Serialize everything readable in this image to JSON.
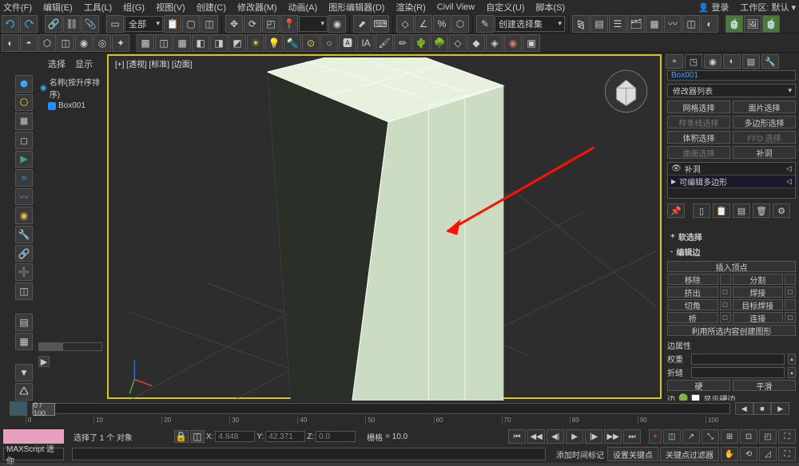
{
  "menu": {
    "file": "文件(F)",
    "edit": "编辑(E)",
    "tools": "工具(L)",
    "group": "组(G)",
    "views": "视图(V)",
    "create": "创建(C)",
    "modifiers": "修改器(M)",
    "animation": "动画(A)",
    "graph": "图形编辑器(D)",
    "render": "渲染(R)",
    "civil": "Civil View",
    "custom": "自定义(U)",
    "script": "脚本(S)",
    "login": "登录",
    "workspace": "工作区: 默认"
  },
  "toolbar": {
    "dropdown1": "全部",
    "dropdown2": "创建选择集"
  },
  "scene": {
    "tabs": {
      "select": "选择",
      "display": "显示"
    },
    "header": "名称(按升序排序)",
    "item": "Box001"
  },
  "viewport": {
    "label": "[+] [透视] [标准] [边面]"
  },
  "cmd": {
    "objname": "Box001",
    "modifier_list": "修改器列表",
    "btns": {
      "mesh_select": "网格选择",
      "face_select": "面片选择",
      "spline_select": "样条线选择",
      "poly_select": "多边形选择",
      "vol_select": "体积选择",
      "ffd_select": "FFD 选择",
      "surf_select": "曲面选择",
      "fill": "补洞"
    },
    "stack": {
      "fill": "补洞",
      "editable": "可编辑多边形"
    },
    "soft_sel": "软选择",
    "edit_edge": "编辑边",
    "insert_vertex": "插入顶点",
    "remove": "移除",
    "split": "分割",
    "extrude": "挤出",
    "weld": "焊接",
    "chamfer": "切角",
    "target_weld": "目标焊接",
    "bridge": "桥",
    "connect": "连接",
    "create_shape": "利用所选内容创建图形",
    "edge_props": "边属性",
    "weight": "权重",
    "crease": "折缝",
    "hard": "硬",
    "smooth": "平滑",
    "edge_label": "边",
    "show_hard": "显示硬边"
  },
  "timeline": {
    "frame": "0 / 100"
  },
  "status": {
    "selection": "选择了 1 个 对象",
    "x": "4.848",
    "y": "42.371",
    "z": "0.0",
    "grid": "栅格",
    "grid_val": "= 10.0",
    "script": "MAXScript 迷你",
    "add_time": "添加时间标记",
    "set_key": "设置关键点",
    "filter": "关键点过滤器"
  }
}
